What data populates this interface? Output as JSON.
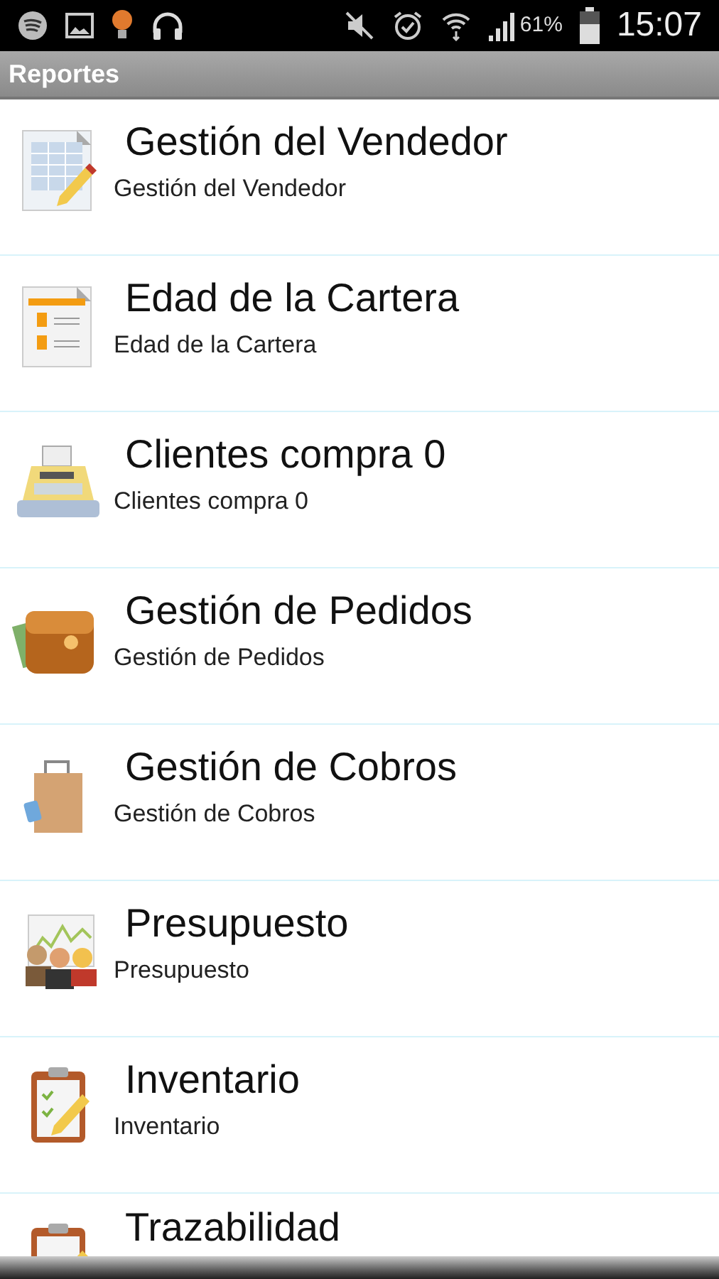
{
  "status_bar": {
    "battery": "61%",
    "time": "15:07"
  },
  "title_bar": {
    "title": "Reportes"
  },
  "reports": [
    {
      "title": "Gestión del Vendedor",
      "subtitle": "Gestión del Vendedor"
    },
    {
      "title": "Edad de la Cartera",
      "subtitle": "Edad de la Cartera"
    },
    {
      "title": "Clientes compra 0",
      "subtitle": "Clientes compra 0"
    },
    {
      "title": "Gestión de Pedidos",
      "subtitle": "Gestión de Pedidos"
    },
    {
      "title": "Gestión de Cobros",
      "subtitle": "Gestión de Cobros"
    },
    {
      "title": "Presupuesto",
      "subtitle": "Presupuesto"
    },
    {
      "title": "Inventario",
      "subtitle": "Inventario"
    },
    {
      "title": "Trazabilidad"
    }
  ]
}
